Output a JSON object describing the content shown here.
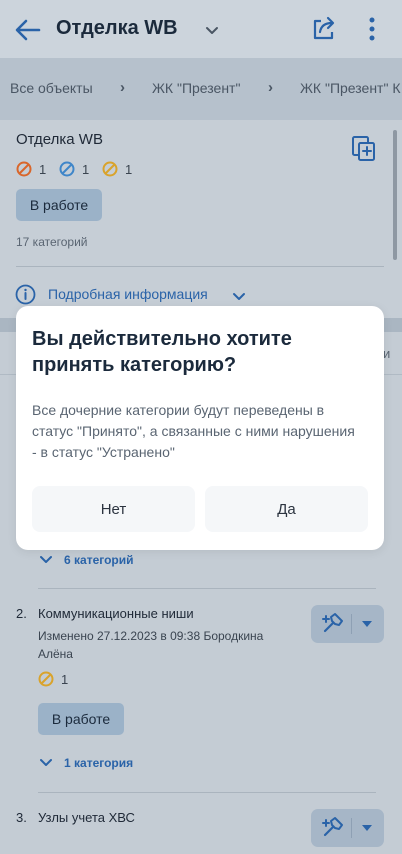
{
  "header": {
    "title": "Отделка WB"
  },
  "breadcrumbs": [
    "Все объекты",
    "ЖК \"Презент\"",
    "ЖК \"Презент\" К"
  ],
  "object": {
    "title": "Отделка WB",
    "counts": [
      {
        "icon": "red-status-icon",
        "value": "1",
        "color": "#d9662b"
      },
      {
        "icon": "blue-status-icon",
        "value": "1",
        "color": "#3f86c9"
      },
      {
        "icon": "yellow-status-icon",
        "value": "1",
        "color": "#d9a32b"
      }
    ],
    "status": "В работе",
    "categories": "17 категорий",
    "info_link": "Подробная информация"
  },
  "hidden_edge_text": "и",
  "dialog": {
    "title": "Вы действительно хотите принять категорию?",
    "text": "Все дочерние категории будут переведены в статус \"Принято\", а связанные с ними нарушения - в статус \"Устранено\"",
    "no_label": "Нет",
    "yes_label": "Да"
  },
  "list": {
    "first_expander": "6 категорий",
    "items": [
      {
        "number": "2.",
        "name": "Коммуникационные ниши",
        "meta": "Изменено 27.12.2023 в 09:38 Бородкина Алёна",
        "count": "1",
        "status": "В работе",
        "expander": "1 категория"
      },
      {
        "number": "3.",
        "name": "Узлы учета ХВС"
      }
    ]
  },
  "colors": {
    "accent": "#2a63a8",
    "overlay": "#c4ccd4",
    "dialog_bg": "#ffffff"
  }
}
